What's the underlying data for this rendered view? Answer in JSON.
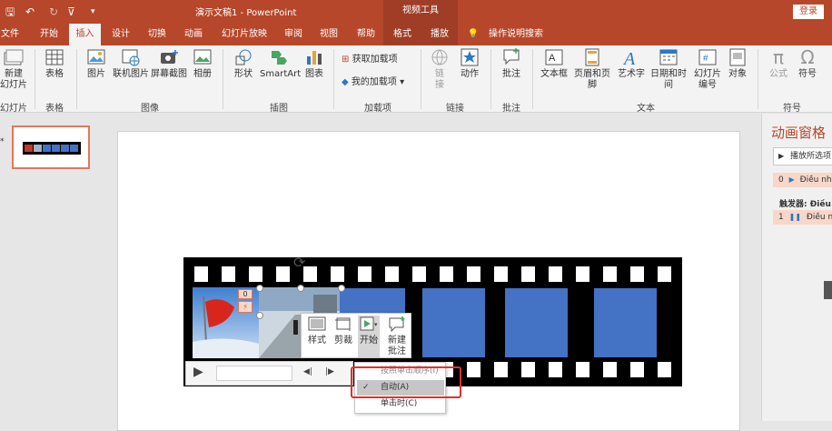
{
  "titlebar": {
    "doc_title": "演示文稿1 - PowerPoint",
    "context_group": "视频工具",
    "login": "登录"
  },
  "tabs": [
    {
      "label": "文件"
    },
    {
      "label": "开始"
    },
    {
      "label": "插入"
    },
    {
      "label": "设计"
    },
    {
      "label": "切换"
    },
    {
      "label": "动画"
    },
    {
      "label": "幻灯片放映"
    },
    {
      "label": "审阅"
    },
    {
      "label": "视图"
    },
    {
      "label": "帮助"
    },
    {
      "label": "格式"
    },
    {
      "label": "播放"
    },
    {
      "label": "操作说明搜索"
    }
  ],
  "ribbon": {
    "new_slide": "新建\n幻灯片",
    "table": "表格",
    "picture": "图片",
    "online_picture": "联机图片",
    "screenshot": "屏幕截图",
    "album": "相册",
    "shapes": "形状",
    "smartart": "SmartArt",
    "chart": "图表",
    "get_addins": "获取加载项",
    "my_addins": "我的加载项",
    "link": "链\n接",
    "action": "动作",
    "comment": "批注",
    "textbox": "文本框",
    "header_footer": "页眉和页脚",
    "wordart": "艺术字",
    "datetime": "日期和时间",
    "slide_number": "幻灯片\n编号",
    "object": "对象",
    "equation": "公式",
    "symbol": "符号",
    "groups": {
      "slides": "幻灯片",
      "tables": "表格",
      "images": "图像",
      "illustrations": "插图",
      "addins": "加载项",
      "links": "链接",
      "comments": "批注",
      "text": "文本",
      "symbols": "符号"
    }
  },
  "animation_pane": {
    "title": "动画窗格",
    "play_selected": "播放所选项",
    "item1_num": "0",
    "item1_label": "Điều nh",
    "trigger_label": "触发器: Điều",
    "item2_num": "1",
    "item2_label": "Điều nh"
  },
  "mini_toolbar": {
    "style": "样式",
    "crop": "剪裁",
    "start": "开始",
    "new_comment": "新建\n批注"
  },
  "dropdown": {
    "items": [
      {
        "label": "按照单击顺序(I)",
        "checked": false
      },
      {
        "label": "自动(A)",
        "checked": true
      },
      {
        "label": "单击时(C)",
        "checked": false
      }
    ]
  },
  "badges": {
    "anim_num": "0",
    "trigger_badge": "⚡"
  },
  "colors": {
    "brand": "#b7472a",
    "film_blue": "#4472c4",
    "highlight_red": "#e03030"
  }
}
